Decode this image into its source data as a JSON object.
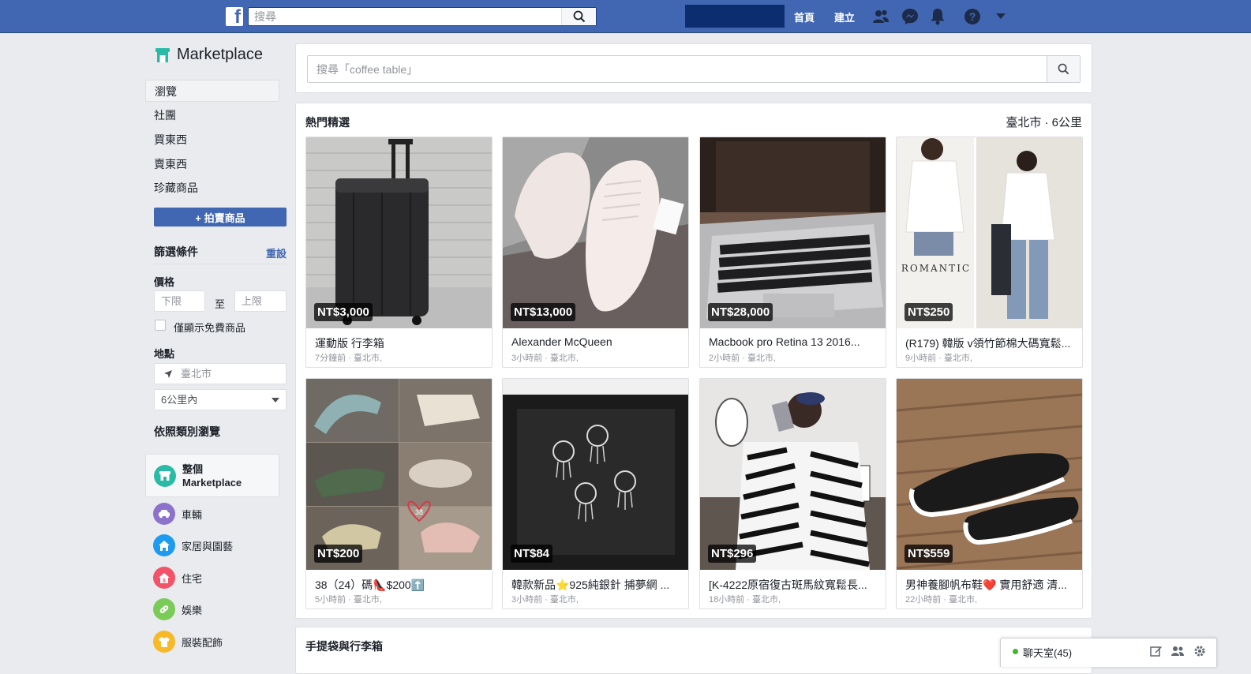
{
  "topbar": {
    "search_placeholder": "搜尋",
    "home_label": "首頁",
    "create_label": "建立"
  },
  "sidebar": {
    "title": "Marketplace",
    "nav": [
      "瀏覽",
      "社團",
      "買東西",
      "賣東西",
      "珍藏商品"
    ],
    "sell_button": "+ 拍賣商品",
    "filters_heading": "篩選條件",
    "reset_link": "重設",
    "price_label": "價格",
    "price_min_placeholder": "下限",
    "price_to": "至",
    "price_max_placeholder": "上限",
    "free_only_label": "僅顯示免費商品",
    "location_label": "地點",
    "location_value": "臺北市",
    "radius_value": "6公里內",
    "categories_heading": "依照類別瀏覽",
    "categories": [
      {
        "label": "整個",
        "label2": "Marketplace",
        "icon": "storefront-icon",
        "color": "#2abba7"
      },
      {
        "label": "車輛",
        "icon": "car-icon",
        "color": "#8c72cb"
      },
      {
        "label": "家居與園藝",
        "icon": "house-icon",
        "color": "#1d9bf0"
      },
      {
        "label": "住宅",
        "icon": "home-price-icon",
        "color": "#f35369"
      },
      {
        "label": "娛樂",
        "icon": "gamepad-icon",
        "color": "#7bcb59"
      },
      {
        "label": "服裝配飾",
        "icon": "shirt-icon",
        "color": "#f7b928"
      }
    ]
  },
  "main": {
    "search_placeholder": "搜尋「coffee table」",
    "featured_title": "熱門精選",
    "location_radius": "臺北市 · 6公里",
    "listings": [
      {
        "price": "NT$3,000",
        "title": "運動版 行李箱",
        "meta": "7分鐘前 · 臺北市,"
      },
      {
        "price": "NT$13,000",
        "title": "Alexander McQueen",
        "meta": "3小時前 · 臺北市,"
      },
      {
        "price": "NT$28,000",
        "title": "Macbook pro Retina 13 2016...",
        "meta": "2小時前 · 臺北市,"
      },
      {
        "price": "NT$250",
        "title": "(R179) 韓版 v領竹節棉大碼寬鬆...",
        "meta": "9小時前 · 臺北市,"
      },
      {
        "price": "NT$200",
        "title": "38（24）碼👠$200⬆️",
        "meta": "5小時前 · 臺北市,"
      },
      {
        "price": "NT$84",
        "title": "韓款新品⭐925純銀針 捕夢網 ...",
        "meta": "3小時前 · 臺北市,"
      },
      {
        "price": "NT$296",
        "title": "[K-4222原宿復古斑馬紋寬鬆長...",
        "meta": "18小時前 · 臺北市,"
      },
      {
        "price": "NT$559",
        "title": "男神養腳帆布鞋❤️ 實用舒適 清...",
        "meta": "22小時前 · 臺北市,"
      }
    ],
    "image_texts": {
      "romantic": "ROMANTIC",
      "heart_number": "38"
    },
    "bags_title": "手提袋與行李箱"
  },
  "chat": {
    "label": "聊天室(45)"
  },
  "colors": {
    "brand_blue": "#4267b2",
    "background": "#e9ebee",
    "online_green": "#42b72a"
  }
}
